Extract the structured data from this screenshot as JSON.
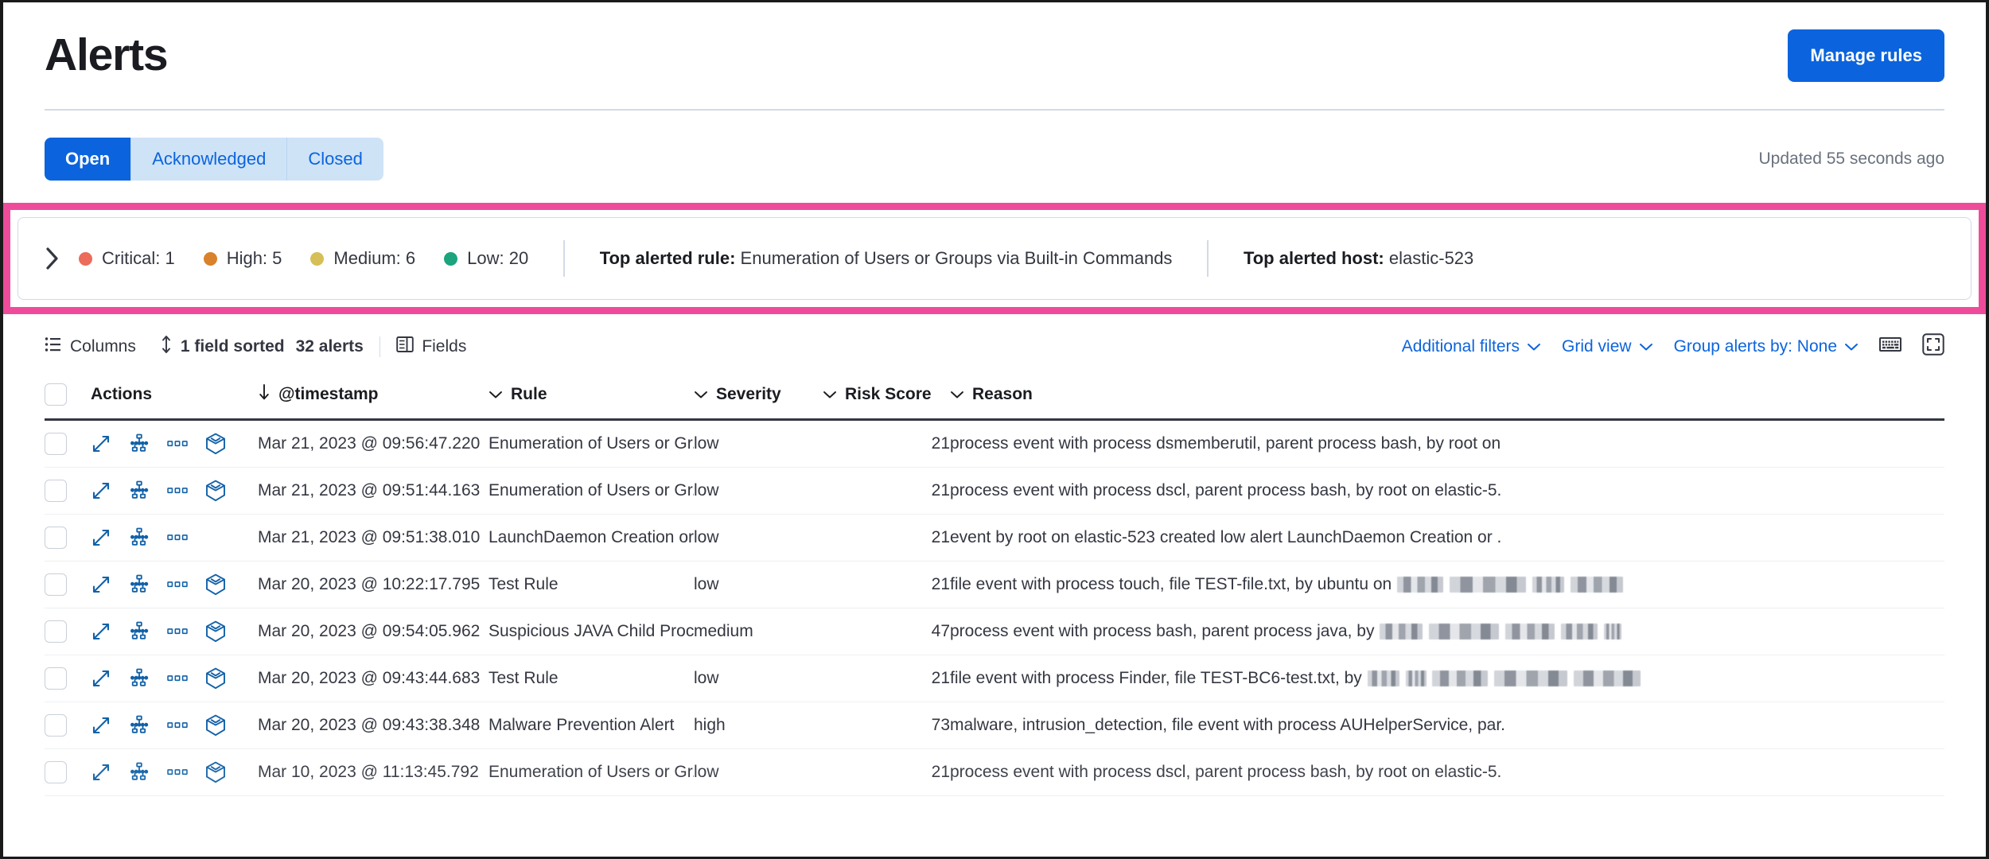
{
  "header": {
    "title": "Alerts",
    "manage_rules_label": "Manage rules"
  },
  "tabs": {
    "items": [
      {
        "label": "Open",
        "active": true
      },
      {
        "label": "Acknowledged",
        "active": false
      },
      {
        "label": "Closed",
        "active": false
      }
    ],
    "updated_text": "Updated 55 seconds ago"
  },
  "summary": {
    "expand_icon": "chevron-right-icon",
    "severities": [
      {
        "label": "Critical: 1",
        "color": "#ec6b5b"
      },
      {
        "label": "High: 5",
        "color": "#d9822b"
      },
      {
        "label": "Medium: 6",
        "color": "#d6bf57"
      },
      {
        "label": "Low: 20",
        "color": "#1ba47e"
      }
    ],
    "top_rule_label": "Top alerted rule:",
    "top_rule_value": "Enumeration of Users or Groups via Built-in Commands",
    "top_host_label": "Top alerted host:",
    "top_host_value": "elastic-523",
    "highlight_color": "#ee4c9b"
  },
  "gridbar": {
    "columns_label": "Columns",
    "sorted_label": "1 field sorted",
    "alerts_count_label": "32 alerts",
    "fields_label": "Fields",
    "additional_filters_label": "Additional filters",
    "grid_view_label": "Grid view",
    "group_alerts_label": "Group alerts by: None",
    "keyboard_icon": "keyboard-icon",
    "fullscreen_icon": "fullscreen-icon"
  },
  "table": {
    "columns": [
      {
        "key": "actions",
        "label": "Actions",
        "sort_icon": ""
      },
      {
        "key": "timestamp",
        "label": "@timestamp",
        "sort_icon": "arrow-down-icon"
      },
      {
        "key": "rule",
        "label": "Rule",
        "sort_icon": "chevron-down-icon"
      },
      {
        "key": "severity",
        "label": "Severity",
        "sort_icon": "chevron-down-icon"
      },
      {
        "key": "risk_score",
        "label": "Risk Score",
        "sort_icon": "chevron-down-icon"
      },
      {
        "key": "reason",
        "label": "Reason",
        "sort_icon": "chevron-down-icon"
      }
    ],
    "rows": [
      {
        "timestamp": "Mar 21, 2023 @ 09:56:47.220",
        "rule": "Enumeration of Users or Gr...",
        "severity": "low",
        "risk_score": "21",
        "reason": "process event with process dsmemberutil, parent process bash, by root on",
        "has_session_view": true,
        "redacted": false
      },
      {
        "timestamp": "Mar 21, 2023 @ 09:51:44.163",
        "rule": "Enumeration of Users or Gr...",
        "severity": "low",
        "risk_score": "21",
        "reason": "process event with process dscl, parent process bash, by root on elastic-5.",
        "has_session_view": true,
        "redacted": false
      },
      {
        "timestamp": "Mar 21, 2023 @ 09:51:38.010",
        "rule": "LaunchDaemon Creation or...",
        "severity": "low",
        "risk_score": "21",
        "reason": "event by root on elastic-523 created low alert LaunchDaemon Creation or .",
        "has_session_view": false,
        "redacted": false
      },
      {
        "timestamp": "Mar 20, 2023 @ 10:22:17.795",
        "rule": "Test Rule",
        "severity": "low",
        "risk_score": "21",
        "reason": "file event with process touch, file TEST-file.txt, by ubuntu on",
        "has_session_view": true,
        "redacted": true
      },
      {
        "timestamp": "Mar 20, 2023 @ 09:54:05.962",
        "rule": "Suspicious JAVA Child Proc...",
        "severity": "medium",
        "risk_score": "47",
        "reason": "process event with process bash, parent process java, by",
        "has_session_view": true,
        "redacted": true
      },
      {
        "timestamp": "Mar 20, 2023 @ 09:43:44.683",
        "rule": "Test Rule",
        "severity": "low",
        "risk_score": "21",
        "reason": "file event with process Finder, file TEST-BC6-test.txt, by",
        "has_session_view": true,
        "redacted": true
      },
      {
        "timestamp": "Mar 20, 2023 @ 09:43:38.348",
        "rule": "Malware Prevention Alert",
        "severity": "high",
        "risk_score": "73",
        "reason": "malware, intrusion_detection, file event with process AUHelperService, par.",
        "has_session_view": true,
        "redacted": false
      },
      {
        "timestamp": "Mar 10, 2023 @ 11:13:45.792",
        "rule": "Enumeration of Users or Gr...",
        "severity": "low",
        "risk_score": "21",
        "reason": "process event with process dscl, parent process bash, by root on elastic-5.",
        "has_session_view": true,
        "redacted": false
      }
    ],
    "action_icons": [
      "expand-icon",
      "analyzer-icon",
      "more-actions-icon",
      "session-view-icon"
    ]
  }
}
